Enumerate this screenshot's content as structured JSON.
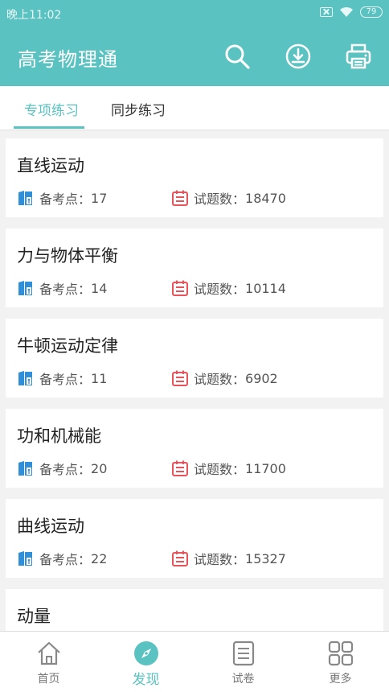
{
  "status_bar": {
    "time": "晚上11:02",
    "battery": "79"
  },
  "app_bar": {
    "title": "高考物理通",
    "icons": [
      "search-icon",
      "download-icon",
      "printer-icon"
    ]
  },
  "tabs": [
    {
      "label": "专项练习",
      "active": true
    },
    {
      "label": "同步练习",
      "active": false
    }
  ],
  "labels": {
    "points_prefix": "备考点：",
    "questions_prefix": "试题数："
  },
  "topics": [
    {
      "name": "直线运动",
      "points": "17",
      "questions": "18470"
    },
    {
      "name": "力与物体平衡",
      "points": "14",
      "questions": "10114"
    },
    {
      "name": "牛顿运动定律",
      "points": "11",
      "questions": "6902"
    },
    {
      "name": "功和机械能",
      "points": "20",
      "questions": "11700"
    },
    {
      "name": "曲线运动",
      "points": "22",
      "questions": "15327"
    },
    {
      "name": "动量"
    }
  ],
  "bottom_nav": [
    {
      "label": "首页",
      "icon": "home-icon",
      "active": false
    },
    {
      "label": "发现",
      "icon": "compass-icon",
      "active": true
    },
    {
      "label": "试卷",
      "icon": "paper-icon",
      "active": false
    },
    {
      "label": "更多",
      "icon": "grid-icon",
      "active": false
    }
  ],
  "colors": {
    "primary": "#5bc2c2",
    "book_icon": "#2f8fd8",
    "calendar_icon": "#e8535b"
  }
}
